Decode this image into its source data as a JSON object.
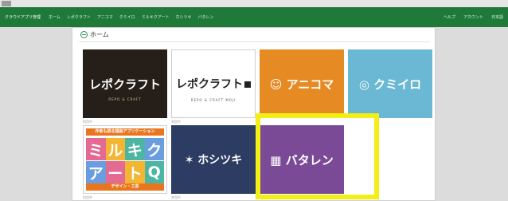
{
  "topbar": {
    "title": "クラウドアプリ管理",
    "nav": [
      "ホーム",
      "レポクラフト",
      "アニコマ",
      "クミイロ",
      "ミルキクアート",
      "ホシツキ",
      "バタレン"
    ],
    "right": [
      "ヘルプ",
      "アカウント",
      "日本語"
    ]
  },
  "home": {
    "title": "ホーム"
  },
  "tiles": [
    {
      "label": "レポクラフト",
      "sub": "REPO & CRAFT",
      "caption": "利用中"
    },
    {
      "label": "レポクラフト",
      "sub": "REPO & CRAFT MOJI",
      "caption": "利用中"
    },
    {
      "label": "アニコマ",
      "caption": ""
    },
    {
      "label": "クミイロ",
      "caption": ""
    },
    {
      "banner": "作者も読る描画アプリケーション",
      "row1": [
        "ミ",
        "ル",
        "キ",
        "ク"
      ],
      "row2": [
        "ア",
        "ー",
        "ト",
        "Q"
      ],
      "bottom": "デザイン・工芸",
      "caption": "利用中"
    },
    {
      "label": "ホシツキ",
      "caption": "利用中"
    },
    {
      "label": "バタレン",
      "caption": "利用中"
    }
  ],
  "colors": {
    "appbar": "#1f7a3a",
    "highlight": "#f3ee16"
  }
}
